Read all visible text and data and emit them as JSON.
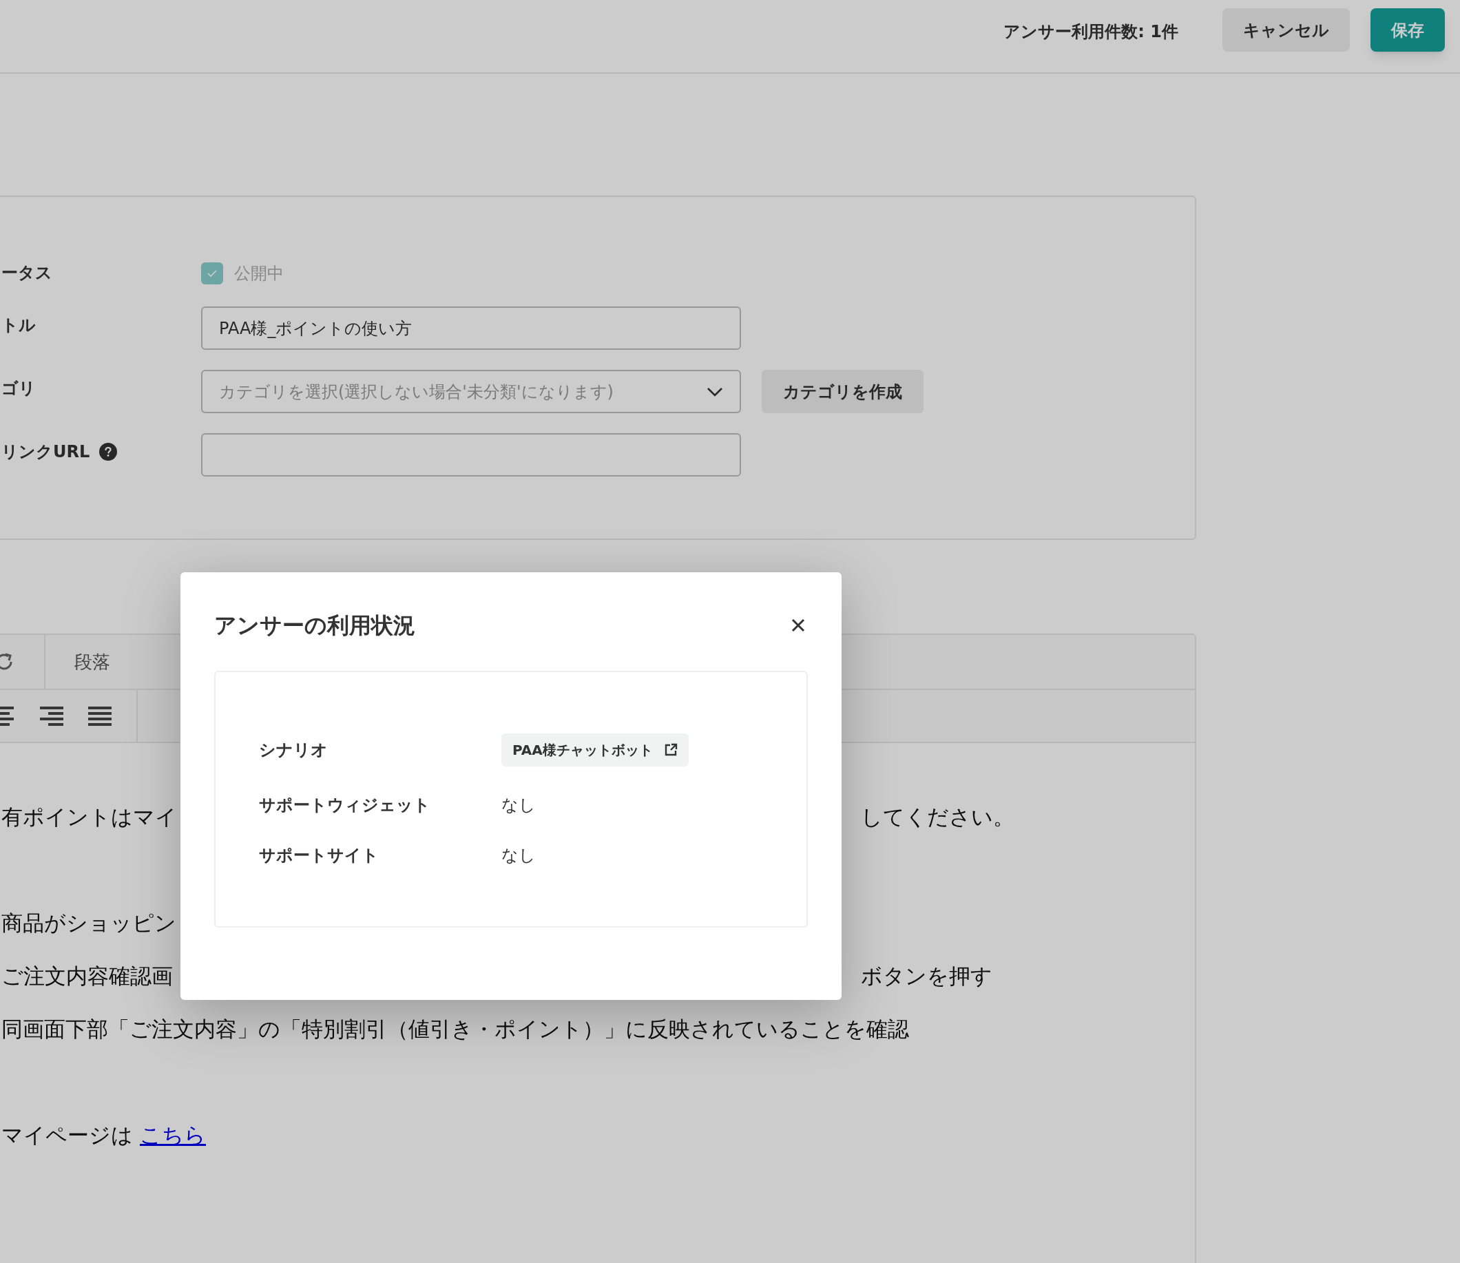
{
  "header": {
    "usage_count": "アンサー利用件数: 1件",
    "buttons": [
      {
        "label": "キャンセル",
        "kind": "secondary"
      },
      {
        "label": "保存",
        "kind": "primary"
      }
    ]
  },
  "form": {
    "fields": [
      {
        "kind": "checkbox",
        "label": "ータス",
        "value": "公開中",
        "checked": true,
        "disabled": true
      },
      {
        "kind": "text",
        "label": "トル",
        "value": "PAA様_ポイントの使い方"
      },
      {
        "kind": "select",
        "label": "ゴリ",
        "placeholder": "カテゴリを選択(選択しない場合'未分類'になります)",
        "button": "カテゴリを作成"
      },
      {
        "kind": "text",
        "label": "リンクURL",
        "help": true
      }
    ]
  },
  "editor": {
    "block_format": "段落",
    "lines": [
      {
        "kind": "text",
        "left": "有ポイントはマイ",
        "right": "してください。"
      },
      {
        "kind": "spacer"
      },
      {
        "kind": "text",
        "left": "商品がショッピン"
      },
      {
        "kind": "text",
        "left": "ご注文内容確認画",
        "right": "ボタンを押す"
      },
      {
        "kind": "text",
        "left": "同画面下部「ご注文内容」の「特別割引（値引き・ポイント）」に反映されていることを確認"
      },
      {
        "kind": "spacer"
      },
      {
        "kind": "link",
        "left": "マイページは",
        "link": "こちら"
      }
    ]
  },
  "modal": {
    "title": "アンサーの利用状況",
    "rows": [
      {
        "label": "シナリオ",
        "kind": "link",
        "value": "PAA様チャットボット"
      },
      {
        "label": "サポートウィジェット",
        "kind": "text",
        "value": "なし"
      },
      {
        "label": "サポートサイト",
        "kind": "text",
        "value": "なし"
      }
    ]
  }
}
